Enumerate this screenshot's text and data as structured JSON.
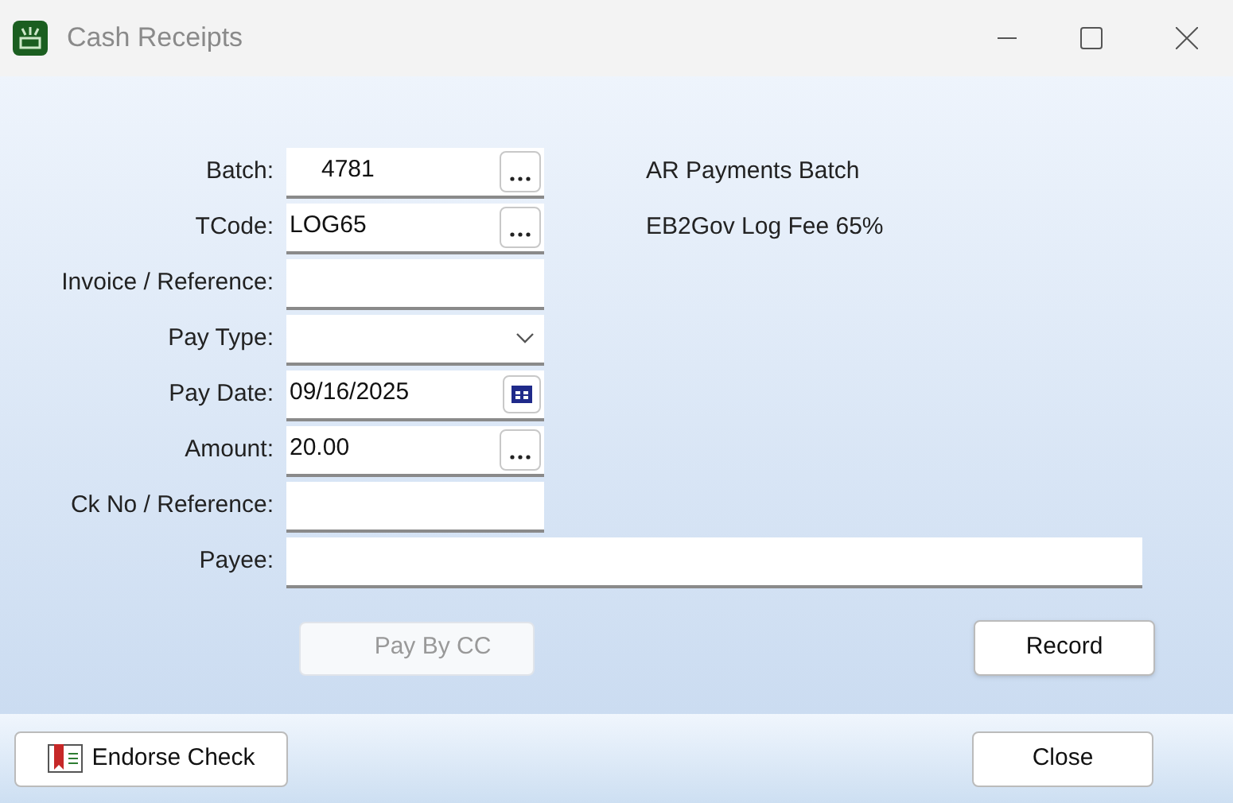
{
  "window": {
    "title": "Cash Receipts"
  },
  "fields": [
    {
      "label": "Batch:",
      "kind": "lookup",
      "value": "4781",
      "indent": true,
      "description": "AR Payments Batch"
    },
    {
      "label": "TCode:",
      "kind": "lookup",
      "value": "LOG65",
      "description": "EB2Gov Log Fee 65%"
    },
    {
      "label": "Invoice / Reference:",
      "kind": "text"
    },
    {
      "label": "Pay Type:",
      "kind": "dropdown"
    },
    {
      "label": "Pay Date:",
      "kind": "date",
      "value": "09/16/2025"
    },
    {
      "label": "Amount:",
      "kind": "lookup",
      "value": "20.00"
    },
    {
      "label": "Ck No / Reference:",
      "kind": "text"
    },
    {
      "label": "Payee:",
      "kind": "wide"
    }
  ],
  "actions": [
    {
      "label": "Pay By CC",
      "disabled": true
    },
    {
      "label": "Record",
      "disabled": false
    }
  ],
  "footer": {
    "left": "Endorse Check",
    "right": "Close"
  }
}
